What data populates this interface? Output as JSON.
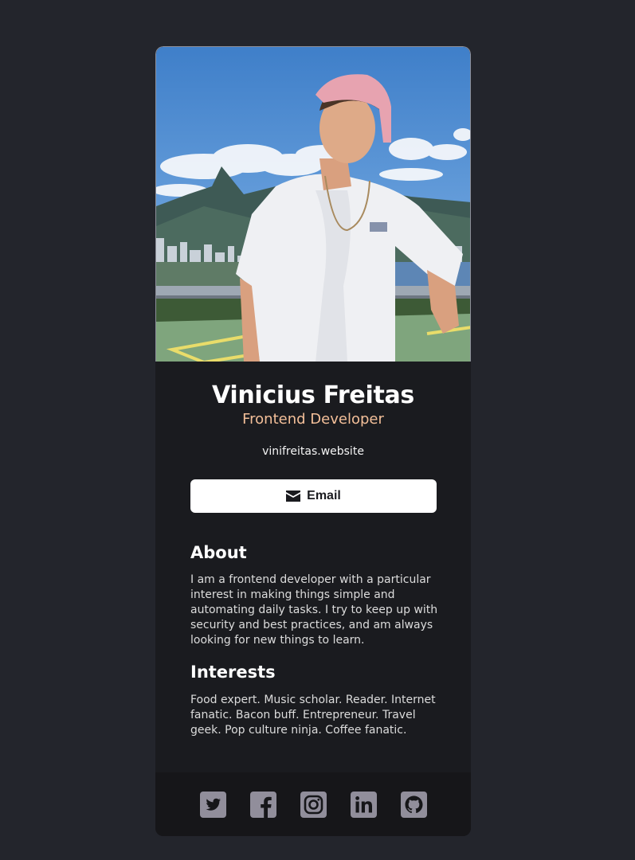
{
  "profile": {
    "name": "Vinicius Freitas",
    "role": "Frontend Developer",
    "website": "vinifreitas.website"
  },
  "email_button": {
    "label": "Email",
    "icon": "envelope-icon"
  },
  "about": {
    "title": "About",
    "text": "I am a frontend developer with a particular interest in making things simple and automating daily tasks. I try to keep up with security and best practices, and am always looking for new things to learn."
  },
  "interests": {
    "title": "Interests",
    "text": "Food expert. Music scholar. Reader. Internet fanatic. Bacon buff. Entrepreneur. Travel geek. Pop culture ninja. Coffee fanatic."
  },
  "social": [
    {
      "icon": "twitter-icon"
    },
    {
      "icon": "facebook-icon"
    },
    {
      "icon": "instagram-icon"
    },
    {
      "icon": "linkedin-icon"
    },
    {
      "icon": "github-icon"
    }
  ],
  "colors": {
    "page_background": "#23252c",
    "card_background": "#1a1b1f",
    "footer_background": "#161619",
    "accent": "#f3bf99",
    "icon_color": "#918e9b"
  }
}
